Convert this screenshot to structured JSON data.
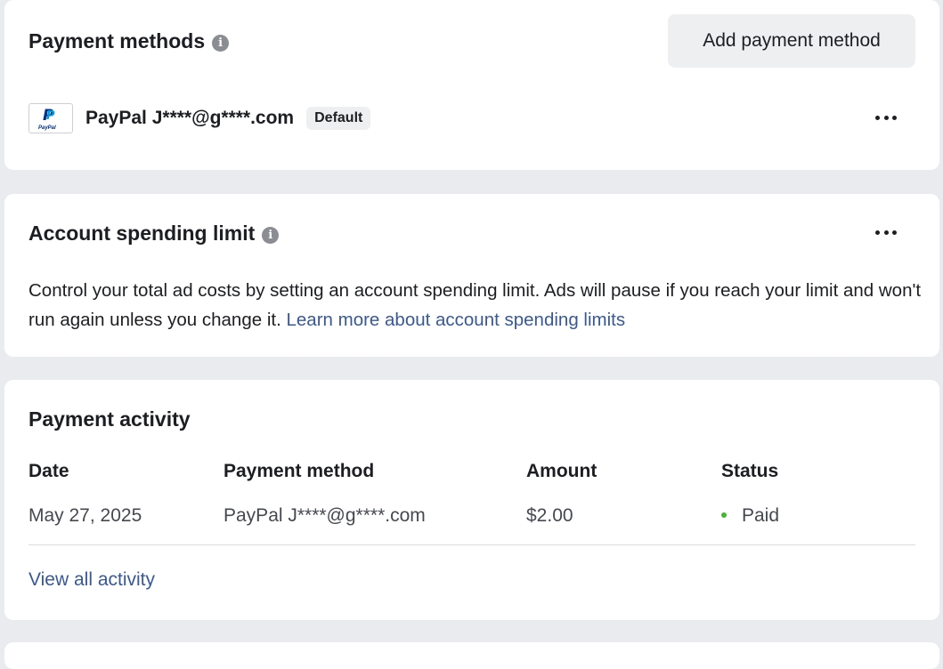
{
  "payment_methods": {
    "title": "Payment methods",
    "add_button_label": "Add payment method",
    "method": {
      "logo_text": "PayPal",
      "name": "PayPal J****@g****.com",
      "badge": "Default"
    }
  },
  "spending_limit": {
    "title": "Account spending limit",
    "description": "Control your total ad costs by setting an account spending limit. Ads will pause if you reach your limit and won't run again unless you change it.",
    "learn_more_link": "Learn more about account spending limits"
  },
  "payment_activity": {
    "title": "Payment activity",
    "columns": {
      "date": "Date",
      "method": "Payment method",
      "amount": "Amount",
      "status": "Status"
    },
    "rows": [
      {
        "date": "May 27, 2025",
        "method": "PayPal J****@g****.com",
        "amount": "$2.00",
        "status": "Paid"
      }
    ],
    "view_all_link": "View all activity"
  },
  "colors": {
    "link": "#385898",
    "status_paid": "#42b72a",
    "page_background": "#e9ebee"
  },
  "icons": {
    "info": "info-icon",
    "more": "more-options-icon",
    "paypal": "paypal-logo"
  }
}
